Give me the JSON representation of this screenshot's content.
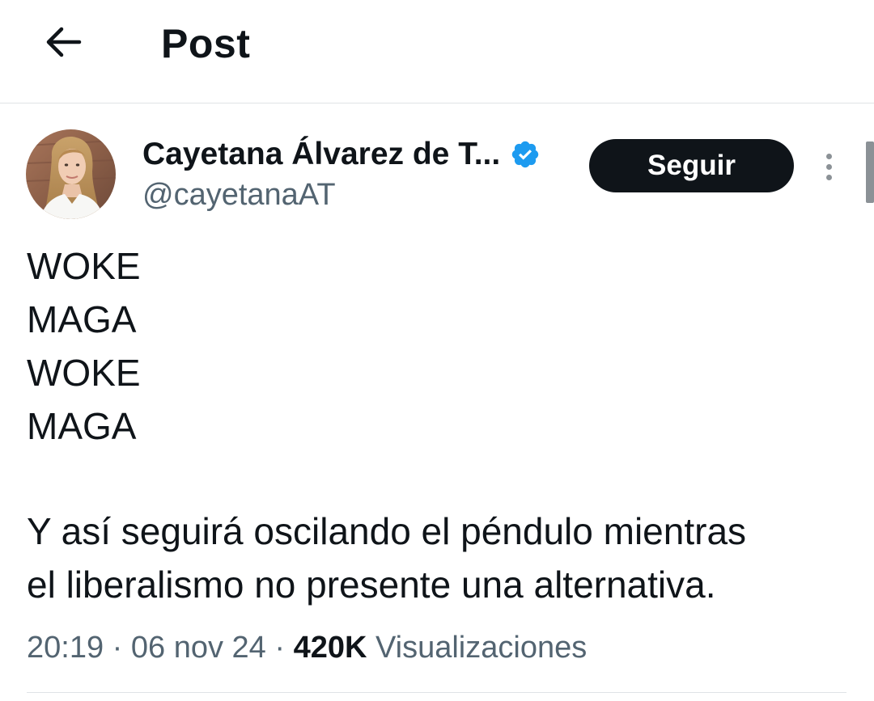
{
  "header": {
    "title": "Post",
    "back_icon": "arrow-left-icon"
  },
  "author": {
    "name": "Cayetana Álvarez de T...",
    "handle": "@cayetanaAT",
    "verified_icon": "verified-badge-icon",
    "verified_color": "#1d9bf0"
  },
  "actions": {
    "follow_label": "Seguir",
    "more_icon": "more-vertical-icon"
  },
  "tweet": {
    "lines": [
      "WOKE",
      "MAGA",
      "WOKE",
      "MAGA"
    ],
    "body_lines": [
      "Y así seguirá oscilando el péndulo mientras",
      "el liberalismo no presente una alternativa."
    ]
  },
  "meta": {
    "time": "20:19",
    "separator": "·",
    "date": "06 nov 24",
    "views_count": "420K",
    "views_label": "Visualizaciones"
  },
  "colors": {
    "text": "#0f1419",
    "secondary_text": "#536471",
    "button_bg": "#0f1419",
    "divider": "#dfe3e6"
  }
}
